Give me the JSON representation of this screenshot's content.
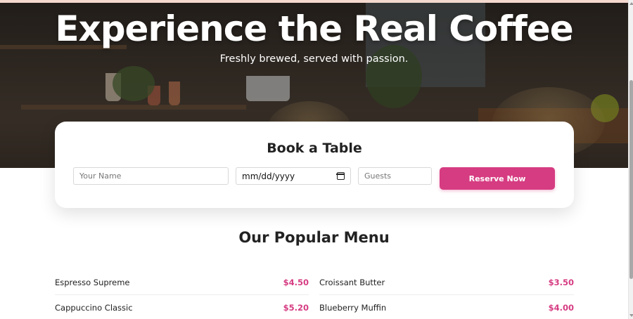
{
  "hero": {
    "title": "Experience the Real Coffee",
    "subtitle": "Freshly brewed, served with passion."
  },
  "booking": {
    "title": "Book a Table",
    "name_placeholder": "Your Name",
    "date_value": "mm/dd/yyyy",
    "guests_placeholder": "Guests",
    "reserve_label": "Reserve Now"
  },
  "menu": {
    "title": "Our Popular Menu",
    "left_items": [
      {
        "name": "Espresso Supreme",
        "price": "$4.50"
      },
      {
        "name": "Cappuccino Classic",
        "price": "$5.20"
      }
    ],
    "right_items": [
      {
        "name": "Croissant Butter",
        "price": "$3.50"
      },
      {
        "name": "Blueberry Muffin",
        "price": "$4.00"
      }
    ]
  },
  "colors": {
    "accent": "#d63c82",
    "hero_overlay": "#2a2622",
    "top_strip": "#f4d9cf"
  },
  "icons": {
    "calendar": "calendar-icon"
  }
}
